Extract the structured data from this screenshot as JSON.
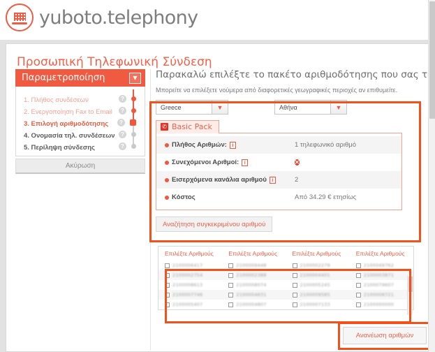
{
  "brand": {
    "name": "yuboto.telephony",
    "logo_icon": "keypad-circle-icon",
    "accent": "#f0573c"
  },
  "page_title": "Προσωπική Τηλεφωνική Σύνδεση",
  "sidebar": {
    "header": "Παραμετροποίηση",
    "caret_icon": "chevron-down-icon",
    "items": [
      {
        "label": "1. Πλήθος συνδέσεων",
        "state": "done"
      },
      {
        "label": "2. Ενεργοποίηση Fax to Email",
        "state": "done"
      },
      {
        "label": "3. Επιλογή αριθμοδότησης",
        "state": "current"
      },
      {
        "label": "4. Ονομασία τηλ. συνδέσεων",
        "state": "todo"
      },
      {
        "label": "5. Περίληψη σύνδεσης",
        "state": "todo"
      }
    ],
    "help_icon": "question-mark-icon",
    "cancel_label": "Ακύρωση"
  },
  "main": {
    "heading": "Παρακαλώ επιλέξτε το πακέτο αριθμοδότησης που σας ταιριάζει",
    "subheading": "Μπορείτε να επιλέξετε νούμερα από διαφορετικές γεωγραφικές περιοχές αν επιθυμείτε.",
    "country_select": {
      "value": "Greece",
      "caret_icon": "chevron-down-icon"
    },
    "city_select": {
      "value": "Αθήνα",
      "caret_icon": "chevron-down-icon"
    },
    "pack": {
      "tab_label": "Basic Pack",
      "tab_icon": "phone-handset-icon",
      "rows": [
        {
          "label": "Πλήθος Αριθμών:",
          "has_info": true,
          "value": "1 τηλεφωνικό αριθμό",
          "value_type": "text"
        },
        {
          "label": "Συνεχόμενοι Αριθμοί:",
          "has_info": true,
          "value": "",
          "value_type": "x-mark",
          "x_icon": "circle-x-icon"
        },
        {
          "label": "Εισερχόμενα κανάλια αριθμού",
          "has_info": true,
          "value": "2",
          "value_type": "text"
        },
        {
          "label": "Κόστος",
          "has_info": false,
          "value": "Από 34.29 € ετησίως",
          "value_type": "text"
        }
      ]
    },
    "search_button": "Αναζήτηση συγκεκριμένου αριθμού"
  },
  "numbers": {
    "column_headers": [
      "Επιλέξτε Αριθμούς",
      "Επιλέξτε Αριθμούς",
      "Επιλέξτε Αριθμούς",
      "Επιλέξτε Αριθμούς"
    ],
    "rows": [
      [
        "2100006417",
        "2100009448",
        "2100002279",
        "2100049762"
      ],
      [
        "2100002754",
        "2100002388",
        "2100004401",
        "2100003871"
      ],
      [
        "2100008613",
        "2100008074",
        "2100005245",
        "2100079607"
      ],
      [
        "2100007746",
        "2100004631",
        "2100009585",
        "2100008721"
      ],
      [
        "2100005407",
        "2100004807",
        "2100007133",
        "2100000000"
      ]
    ],
    "checkbox_icon": "checkbox-unchecked-icon",
    "refresh_button": "Ανανέωση αριθμών"
  }
}
